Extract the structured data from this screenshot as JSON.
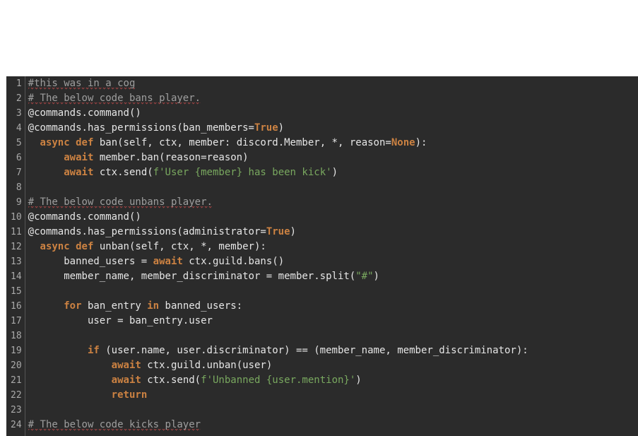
{
  "chart_data": null,
  "editor": {
    "language": "python",
    "gutter_start": 1,
    "gutter_end": 24,
    "lines": [
      {
        "n": 1,
        "tokens": [
          {
            "t": "#this was in a cog",
            "c": "tok-comment",
            "sq": true
          }
        ]
      },
      {
        "n": 2,
        "tokens": [
          {
            "t": "# The below code bans player.",
            "c": "tok-comment",
            "sq": true
          }
        ]
      },
      {
        "n": 3,
        "tokens": [
          {
            "t": "@commands.command()",
            "c": "tok-deco"
          }
        ]
      },
      {
        "n": 4,
        "tokens": [
          {
            "t": "@commands.has_permissions(ban_members=",
            "c": "tok-deco"
          },
          {
            "t": "True",
            "c": "tok-true"
          },
          {
            "t": ")",
            "c": "tok-deco"
          }
        ]
      },
      {
        "n": 5,
        "tokens": [
          {
            "t": "  ",
            "c": ""
          },
          {
            "t": "async",
            "c": "tok-async"
          },
          {
            "t": " ",
            "c": ""
          },
          {
            "t": "def",
            "c": "tok-kw"
          },
          {
            "t": " ban(self, ctx, member: discord.Member, *, reason=",
            "c": "tok-fn"
          },
          {
            "t": "None",
            "c": "tok-none"
          },
          {
            "t": "):",
            "c": "tok-fn"
          }
        ]
      },
      {
        "n": 6,
        "tokens": [
          {
            "t": "      ",
            "c": ""
          },
          {
            "t": "await",
            "c": "tok-await"
          },
          {
            "t": " member.ban(reason=reason)",
            "c": "tok-fn"
          }
        ]
      },
      {
        "n": 7,
        "tokens": [
          {
            "t": "      ",
            "c": ""
          },
          {
            "t": "await",
            "c": "tok-await"
          },
          {
            "t": " ctx.send(",
            "c": "tok-fn"
          },
          {
            "t": "f",
            "c": "tok-fstrpre"
          },
          {
            "t": "'User {member} has been kick'",
            "c": "tok-str"
          },
          {
            "t": ")",
            "c": "tok-fn"
          }
        ]
      },
      {
        "n": 8,
        "tokens": [
          {
            "t": "",
            "c": ""
          }
        ]
      },
      {
        "n": 9,
        "tokens": [
          {
            "t": "# The below code unbans player.",
            "c": "tok-comment",
            "sq": true
          }
        ]
      },
      {
        "n": 10,
        "tokens": [
          {
            "t": "@commands.command()",
            "c": "tok-deco"
          }
        ]
      },
      {
        "n": 11,
        "tokens": [
          {
            "t": "@commands.has_permissions(administrator=",
            "c": "tok-deco"
          },
          {
            "t": "True",
            "c": "tok-true"
          },
          {
            "t": ")",
            "c": "tok-deco"
          }
        ]
      },
      {
        "n": 12,
        "tokens": [
          {
            "t": "  ",
            "c": ""
          },
          {
            "t": "async",
            "c": "tok-async"
          },
          {
            "t": " ",
            "c": ""
          },
          {
            "t": "def",
            "c": "tok-kw"
          },
          {
            "t": " unban(self, ctx, *, member):",
            "c": "tok-fn"
          }
        ]
      },
      {
        "n": 13,
        "tokens": [
          {
            "t": "      banned_users = ",
            "c": "tok-fn"
          },
          {
            "t": "await",
            "c": "tok-await"
          },
          {
            "t": " ctx.guild.bans()",
            "c": "tok-fn"
          }
        ]
      },
      {
        "n": 14,
        "tokens": [
          {
            "t": "      member_name, member_discriminator = member.split(",
            "c": "tok-fn"
          },
          {
            "t": "\"#\"",
            "c": "tok-str"
          },
          {
            "t": ")",
            "c": "tok-fn"
          }
        ]
      },
      {
        "n": 15,
        "tokens": [
          {
            "t": "",
            "c": ""
          }
        ]
      },
      {
        "n": 16,
        "tokens": [
          {
            "t": "      ",
            "c": ""
          },
          {
            "t": "for",
            "c": "tok-for"
          },
          {
            "t": " ban_entry ",
            "c": "tok-fn"
          },
          {
            "t": "in",
            "c": "tok-in"
          },
          {
            "t": " banned_users:",
            "c": "tok-fn"
          }
        ]
      },
      {
        "n": 17,
        "tokens": [
          {
            "t": "          user = ban_entry.user",
            "c": "tok-fn"
          }
        ]
      },
      {
        "n": 18,
        "tokens": [
          {
            "t": "",
            "c": ""
          }
        ]
      },
      {
        "n": 19,
        "tokens": [
          {
            "t": "          ",
            "c": ""
          },
          {
            "t": "if",
            "c": "tok-if"
          },
          {
            "t": " (user.name, user.discriminator) == (member_name, member_discriminator):",
            "c": "tok-fn"
          }
        ]
      },
      {
        "n": 20,
        "tokens": [
          {
            "t": "              ",
            "c": ""
          },
          {
            "t": "await",
            "c": "tok-await"
          },
          {
            "t": " ctx.guild.unban(user)",
            "c": "tok-fn"
          }
        ]
      },
      {
        "n": 21,
        "tokens": [
          {
            "t": "              ",
            "c": ""
          },
          {
            "t": "await",
            "c": "tok-await"
          },
          {
            "t": " ctx.send(",
            "c": "tok-fn"
          },
          {
            "t": "f",
            "c": "tok-fstrpre"
          },
          {
            "t": "'Unbanned {user.mention}'",
            "c": "tok-str"
          },
          {
            "t": ")",
            "c": "tok-fn"
          }
        ]
      },
      {
        "n": 22,
        "tokens": [
          {
            "t": "              ",
            "c": ""
          },
          {
            "t": "return",
            "c": "tok-return"
          }
        ]
      },
      {
        "n": 23,
        "tokens": [
          {
            "t": "",
            "c": ""
          }
        ]
      },
      {
        "n": 24,
        "tokens": [
          {
            "t": "# The below code kicks player",
            "c": "tok-comment",
            "sq": true
          }
        ]
      }
    ]
  }
}
